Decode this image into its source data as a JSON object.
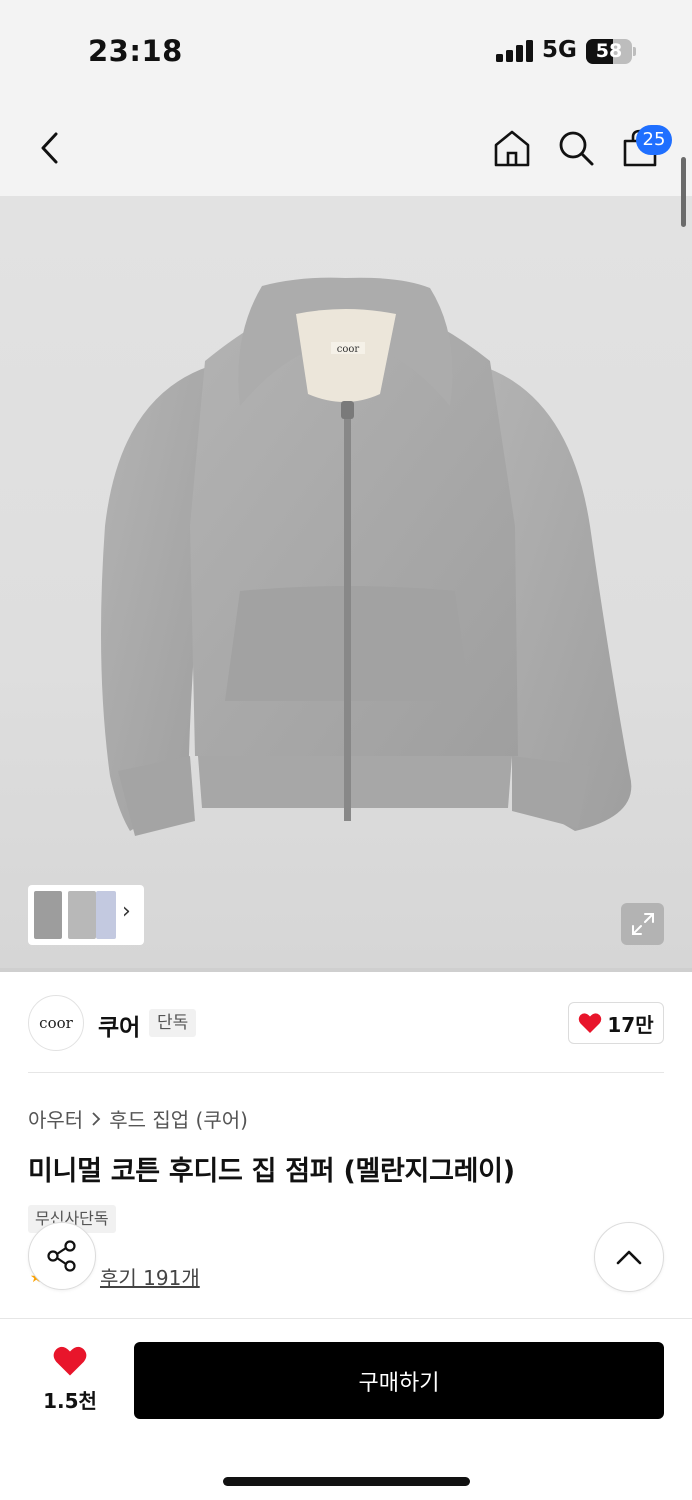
{
  "status_bar": {
    "time": "23:18",
    "network": "5G",
    "battery": "58",
    "battery_level": 0.58
  },
  "nav": {
    "cart_count": "25"
  },
  "gallery": {
    "thumb_more": "›",
    "hoodie_label": "coor"
  },
  "brand": {
    "logo_text": "coor",
    "name": "쿠어",
    "badge": "단독",
    "likes": "17만"
  },
  "product": {
    "breadcrumb": [
      "아우터",
      "후드 집업 (쿠어)"
    ],
    "title": "미니멀 코튼 후디드 집 점퍼 (멜란지그레이)",
    "store_badge": "무신사단독",
    "review_label": "후기 191개"
  },
  "bottom": {
    "wish_count": "1.5천",
    "buy_label": "구매하기"
  },
  "colors": {
    "accent": "#1f6fff",
    "heart": "#e8152b",
    "buy_bg": "#000000",
    "hoodie": "#a9a9a9"
  }
}
